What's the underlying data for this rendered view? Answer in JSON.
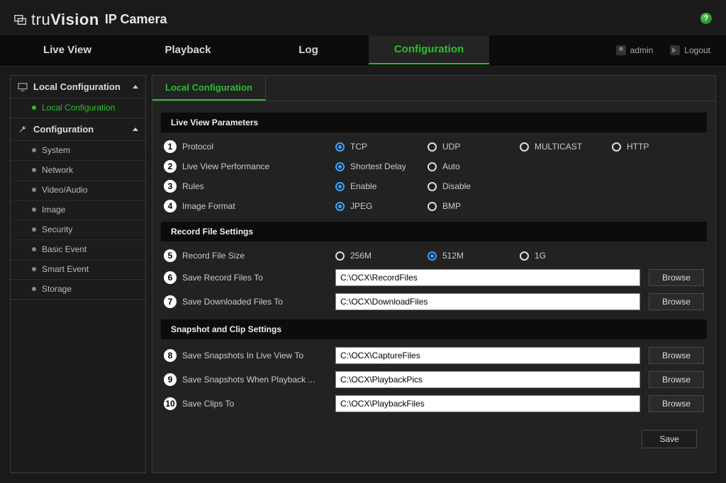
{
  "brand": {
    "prefix": "tru",
    "suffix": "Vision",
    "subtitle": "IP Camera"
  },
  "nav": {
    "tabs": [
      "Live View",
      "Playback",
      "Log",
      "Configuration"
    ],
    "active": 3,
    "user": "admin",
    "logout": "Logout"
  },
  "sidebar": {
    "sections": [
      {
        "title": "Local Configuration",
        "items": [
          "Local Configuration"
        ],
        "activeItem": 0
      },
      {
        "title": "Configuration",
        "items": [
          "System",
          "Network",
          "Video/Audio",
          "Image",
          "Security",
          "Basic Event",
          "Smart Event",
          "Storage"
        ]
      }
    ]
  },
  "content": {
    "tab": "Local Configuration",
    "sections": {
      "live": {
        "title": "Live View Parameters",
        "rows": [
          {
            "n": "1",
            "label": "Protocol",
            "options": [
              "TCP",
              "UDP",
              "MULTICAST",
              "HTTP"
            ],
            "selected": 0
          },
          {
            "n": "2",
            "label": "Live View Performance",
            "options": [
              "Shortest Delay",
              "Auto"
            ],
            "selected": 0
          },
          {
            "n": "3",
            "label": "Rules",
            "options": [
              "Enable",
              "Disable"
            ],
            "selected": 0
          },
          {
            "n": "4",
            "label": "Image Format",
            "options": [
              "JPEG",
              "BMP"
            ],
            "selected": 0
          }
        ]
      },
      "record": {
        "title": "Record File Settings",
        "sizeRow": {
          "n": "5",
          "label": "Record File Size",
          "options": [
            "256M",
            "512M",
            "1G"
          ],
          "selected": 1
        },
        "pathRows": [
          {
            "n": "6",
            "label": "Save Record Files To",
            "value": "C:\\OCX\\RecordFiles"
          },
          {
            "n": "7",
            "label": "Save Downloaded Files To",
            "value": "C:\\OCX\\DownloadFiles"
          }
        ]
      },
      "snap": {
        "title": "Snapshot and Clip Settings",
        "pathRows": [
          {
            "n": "8",
            "label": "Save Snapshots In Live View To",
            "value": "C:\\OCX\\CaptureFiles"
          },
          {
            "n": "9",
            "label": "Save Snapshots When Playback ...",
            "value": "C:\\OCX\\PlaybackPics"
          },
          {
            "n": "10",
            "label": "Save Clips To",
            "value": "C:\\OCX\\PlaybackFiles"
          }
        ]
      }
    },
    "browse": "Browse",
    "save": "Save"
  }
}
